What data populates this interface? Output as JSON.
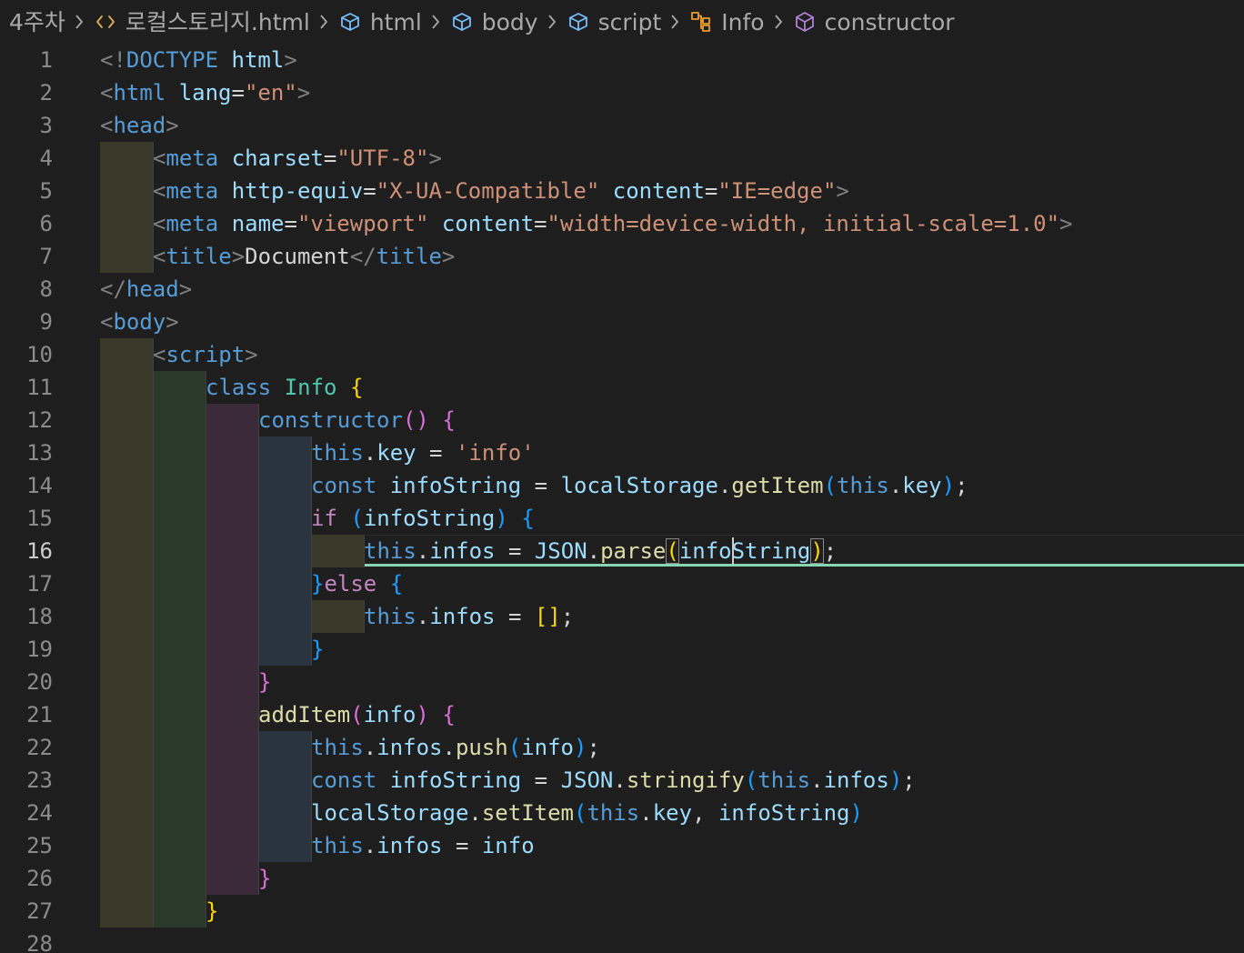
{
  "breadcrumb": [
    {
      "label": "4주차",
      "icon": "folder-icon",
      "icon_color": ""
    },
    {
      "label": "로컬스토리지.html",
      "icon": "html-file-icon",
      "icon_color": "#e8ab53"
    },
    {
      "label": "html",
      "icon": "element-icon",
      "icon_color": "#75beff"
    },
    {
      "label": "body",
      "icon": "element-icon",
      "icon_color": "#75beff"
    },
    {
      "label": "script",
      "icon": "element-icon",
      "icon_color": "#75beff"
    },
    {
      "label": "Info",
      "icon": "class-icon",
      "icon_color": "#ee9d28"
    },
    {
      "label": "constructor",
      "icon": "method-icon",
      "icon_color": "#b180d7"
    }
  ],
  "editor": {
    "current_line": 16,
    "colors": {
      "punct": "#808080",
      "tag": "#569cd6",
      "attr": "#9cdcfe",
      "string": "#ce9178",
      "text": "#d4d4d4",
      "keyword": "#569cd6",
      "control": "#c586c0",
      "class": "#4ec9b0",
      "function": "#dcdcaa",
      "variable": "#9cdcfe",
      "bracket1": "#ffd700",
      "bracket2": "#da70d6",
      "bracket3": "#179fff",
      "cursor_line": "#86d6b3"
    },
    "lines": [
      {
        "n": 1,
        "indent": 0,
        "tokens": [
          {
            "t": "<!",
            "c": "punct"
          },
          {
            "t": "DOCTYPE",
            "c": "tag"
          },
          {
            "t": " ",
            "c": "text"
          },
          {
            "t": "html",
            "c": "attr"
          },
          {
            "t": ">",
            "c": "punct"
          }
        ]
      },
      {
        "n": 2,
        "indent": 0,
        "tokens": [
          {
            "t": "<",
            "c": "punct"
          },
          {
            "t": "html",
            "c": "tag"
          },
          {
            "t": " ",
            "c": "text"
          },
          {
            "t": "lang",
            "c": "attr"
          },
          {
            "t": "=",
            "c": "text"
          },
          {
            "t": "\"en\"",
            "c": "string"
          },
          {
            "t": ">",
            "c": "punct"
          }
        ]
      },
      {
        "n": 3,
        "indent": 0,
        "tokens": [
          {
            "t": "<",
            "c": "punct"
          },
          {
            "t": "head",
            "c": "tag"
          },
          {
            "t": ">",
            "c": "punct"
          }
        ]
      },
      {
        "n": 4,
        "indent": 1,
        "tokens": [
          {
            "t": "<",
            "c": "punct"
          },
          {
            "t": "meta",
            "c": "tag"
          },
          {
            "t": " ",
            "c": "text"
          },
          {
            "t": "charset",
            "c": "attr"
          },
          {
            "t": "=",
            "c": "text"
          },
          {
            "t": "\"UTF-8\"",
            "c": "string"
          },
          {
            "t": ">",
            "c": "punct"
          }
        ]
      },
      {
        "n": 5,
        "indent": 1,
        "tokens": [
          {
            "t": "<",
            "c": "punct"
          },
          {
            "t": "meta",
            "c": "tag"
          },
          {
            "t": " ",
            "c": "text"
          },
          {
            "t": "http-equiv",
            "c": "attr"
          },
          {
            "t": "=",
            "c": "text"
          },
          {
            "t": "\"X-UA-Compatible\"",
            "c": "string"
          },
          {
            "t": " ",
            "c": "text"
          },
          {
            "t": "content",
            "c": "attr"
          },
          {
            "t": "=",
            "c": "text"
          },
          {
            "t": "\"IE=edge\"",
            "c": "string"
          },
          {
            "t": ">",
            "c": "punct"
          }
        ]
      },
      {
        "n": 6,
        "indent": 1,
        "tokens": [
          {
            "t": "<",
            "c": "punct"
          },
          {
            "t": "meta",
            "c": "tag"
          },
          {
            "t": " ",
            "c": "text"
          },
          {
            "t": "name",
            "c": "attr"
          },
          {
            "t": "=",
            "c": "text"
          },
          {
            "t": "\"viewport\"",
            "c": "string"
          },
          {
            "t": " ",
            "c": "text"
          },
          {
            "t": "content",
            "c": "attr"
          },
          {
            "t": "=",
            "c": "text"
          },
          {
            "t": "\"width=device-width, initial-scale=1.0\"",
            "c": "string"
          },
          {
            "t": ">",
            "c": "punct"
          }
        ]
      },
      {
        "n": 7,
        "indent": 1,
        "tokens": [
          {
            "t": "<",
            "c": "punct"
          },
          {
            "t": "title",
            "c": "tag"
          },
          {
            "t": ">",
            "c": "punct"
          },
          {
            "t": "Document",
            "c": "text"
          },
          {
            "t": "</",
            "c": "punct"
          },
          {
            "t": "title",
            "c": "tag"
          },
          {
            "t": ">",
            "c": "punct"
          }
        ]
      },
      {
        "n": 8,
        "indent": 0,
        "tokens": [
          {
            "t": "</",
            "c": "punct"
          },
          {
            "t": "head",
            "c": "tag"
          },
          {
            "t": ">",
            "c": "punct"
          }
        ]
      },
      {
        "n": 9,
        "indent": 0,
        "tokens": [
          {
            "t": "<",
            "c": "punct"
          },
          {
            "t": "body",
            "c": "tag"
          },
          {
            "t": ">",
            "c": "punct"
          }
        ]
      },
      {
        "n": 10,
        "indent": 1,
        "tokens": [
          {
            "t": "<",
            "c": "punct"
          },
          {
            "t": "script",
            "c": "tag"
          },
          {
            "t": ">",
            "c": "punct"
          }
        ]
      },
      {
        "n": 11,
        "indent": 2,
        "tokens": [
          {
            "t": "class",
            "c": "keyword"
          },
          {
            "t": " ",
            "c": "text"
          },
          {
            "t": "Info",
            "c": "class"
          },
          {
            "t": " ",
            "c": "text"
          },
          {
            "t": "{",
            "c": "bracket1"
          }
        ]
      },
      {
        "n": 12,
        "indent": 3,
        "tokens": [
          {
            "t": "constructor",
            "c": "keyword"
          },
          {
            "t": "()",
            "c": "bracket2"
          },
          {
            "t": " ",
            "c": "text"
          },
          {
            "t": "{",
            "c": "bracket2"
          }
        ]
      },
      {
        "n": 13,
        "indent": 4,
        "tokens": [
          {
            "t": "this",
            "c": "keyword"
          },
          {
            "t": ".",
            "c": "text"
          },
          {
            "t": "key",
            "c": "variable"
          },
          {
            "t": " = ",
            "c": "text"
          },
          {
            "t": "'info'",
            "c": "string"
          }
        ]
      },
      {
        "n": 14,
        "indent": 4,
        "tokens": [
          {
            "t": "const",
            "c": "keyword"
          },
          {
            "t": " ",
            "c": "text"
          },
          {
            "t": "infoString",
            "c": "variable"
          },
          {
            "t": " = ",
            "c": "text"
          },
          {
            "t": "localStorage",
            "c": "variable"
          },
          {
            "t": ".",
            "c": "text"
          },
          {
            "t": "getItem",
            "c": "function"
          },
          {
            "t": "(",
            "c": "bracket3"
          },
          {
            "t": "this",
            "c": "keyword"
          },
          {
            "t": ".",
            "c": "text"
          },
          {
            "t": "key",
            "c": "variable"
          },
          {
            "t": ")",
            "c": "bracket3"
          },
          {
            "t": ";",
            "c": "text"
          }
        ]
      },
      {
        "n": 15,
        "indent": 4,
        "tokens": [
          {
            "t": "if",
            "c": "control"
          },
          {
            "t": " ",
            "c": "text"
          },
          {
            "t": "(",
            "c": "bracket3"
          },
          {
            "t": "infoString",
            "c": "variable"
          },
          {
            "t": ")",
            "c": "bracket3"
          },
          {
            "t": " ",
            "c": "text"
          },
          {
            "t": "{",
            "c": "bracket3"
          }
        ]
      },
      {
        "n": 16,
        "indent": 5,
        "tokens": [
          {
            "t": "this",
            "c": "keyword"
          },
          {
            "t": ".",
            "c": "text"
          },
          {
            "t": "infos",
            "c": "variable"
          },
          {
            "t": " = ",
            "c": "text"
          },
          {
            "t": "JSON",
            "c": "variable"
          },
          {
            "t": ".",
            "c": "text"
          },
          {
            "t": "parse",
            "c": "function"
          },
          {
            "t": "(",
            "c": "bracket1",
            "box": true
          },
          {
            "t": "infoString",
            "c": "variable"
          },
          {
            "t": ")",
            "c": "bracket1",
            "box": true
          },
          {
            "t": ";",
            "c": "text"
          }
        ]
      },
      {
        "n": 17,
        "indent": 4,
        "tokens": [
          {
            "t": "}",
            "c": "bracket3"
          },
          {
            "t": "else",
            "c": "control"
          },
          {
            "t": " ",
            "c": "text"
          },
          {
            "t": "{",
            "c": "bracket3"
          }
        ]
      },
      {
        "n": 18,
        "indent": 5,
        "tokens": [
          {
            "t": "this",
            "c": "keyword"
          },
          {
            "t": ".",
            "c": "text"
          },
          {
            "t": "infos",
            "c": "variable"
          },
          {
            "t": " = ",
            "c": "text"
          },
          {
            "t": "[]",
            "c": "bracket1"
          },
          {
            "t": ";",
            "c": "text"
          }
        ]
      },
      {
        "n": 19,
        "indent": 4,
        "tokens": [
          {
            "t": "}",
            "c": "bracket3"
          }
        ]
      },
      {
        "n": 20,
        "indent": 3,
        "tokens": [
          {
            "t": "}",
            "c": "bracket2"
          }
        ]
      },
      {
        "n": 21,
        "indent": 3,
        "tokens": [
          {
            "t": "addItem",
            "c": "function"
          },
          {
            "t": "(",
            "c": "bracket2"
          },
          {
            "t": "info",
            "c": "variable"
          },
          {
            "t": ")",
            "c": "bracket2"
          },
          {
            "t": " ",
            "c": "text"
          },
          {
            "t": "{",
            "c": "bracket2"
          }
        ]
      },
      {
        "n": 22,
        "indent": 4,
        "tokens": [
          {
            "t": "this",
            "c": "keyword"
          },
          {
            "t": ".",
            "c": "text"
          },
          {
            "t": "infos",
            "c": "variable"
          },
          {
            "t": ".",
            "c": "text"
          },
          {
            "t": "push",
            "c": "function"
          },
          {
            "t": "(",
            "c": "bracket3"
          },
          {
            "t": "info",
            "c": "variable"
          },
          {
            "t": ")",
            "c": "bracket3"
          },
          {
            "t": ";",
            "c": "text"
          }
        ]
      },
      {
        "n": 23,
        "indent": 4,
        "tokens": [
          {
            "t": "const",
            "c": "keyword"
          },
          {
            "t": " ",
            "c": "text"
          },
          {
            "t": "infoString",
            "c": "variable"
          },
          {
            "t": " = ",
            "c": "text"
          },
          {
            "t": "JSON",
            "c": "variable"
          },
          {
            "t": ".",
            "c": "text"
          },
          {
            "t": "stringify",
            "c": "function"
          },
          {
            "t": "(",
            "c": "bracket3"
          },
          {
            "t": "this",
            "c": "keyword"
          },
          {
            "t": ".",
            "c": "text"
          },
          {
            "t": "infos",
            "c": "variable"
          },
          {
            "t": ")",
            "c": "bracket3"
          },
          {
            "t": ";",
            "c": "text"
          }
        ]
      },
      {
        "n": 24,
        "indent": 4,
        "tokens": [
          {
            "t": "localStorage",
            "c": "variable"
          },
          {
            "t": ".",
            "c": "text"
          },
          {
            "t": "setItem",
            "c": "function"
          },
          {
            "t": "(",
            "c": "bracket3"
          },
          {
            "t": "this",
            "c": "keyword"
          },
          {
            "t": ".",
            "c": "text"
          },
          {
            "t": "key",
            "c": "variable"
          },
          {
            "t": ", ",
            "c": "text"
          },
          {
            "t": "infoString",
            "c": "variable"
          },
          {
            "t": ")",
            "c": "bracket3"
          }
        ]
      },
      {
        "n": 25,
        "indent": 4,
        "tokens": [
          {
            "t": "this",
            "c": "keyword"
          },
          {
            "t": ".",
            "c": "text"
          },
          {
            "t": "infos",
            "c": "variable"
          },
          {
            "t": " = ",
            "c": "text"
          },
          {
            "t": "info",
            "c": "variable"
          }
        ]
      },
      {
        "n": 26,
        "indent": 3,
        "tokens": [
          {
            "t": "}",
            "c": "bracket2"
          }
        ]
      },
      {
        "n": 27,
        "indent": 2,
        "tokens": [
          {
            "t": "}",
            "c": "bracket1"
          }
        ]
      },
      {
        "n": 28,
        "indent": 0,
        "tokens": []
      }
    ]
  }
}
